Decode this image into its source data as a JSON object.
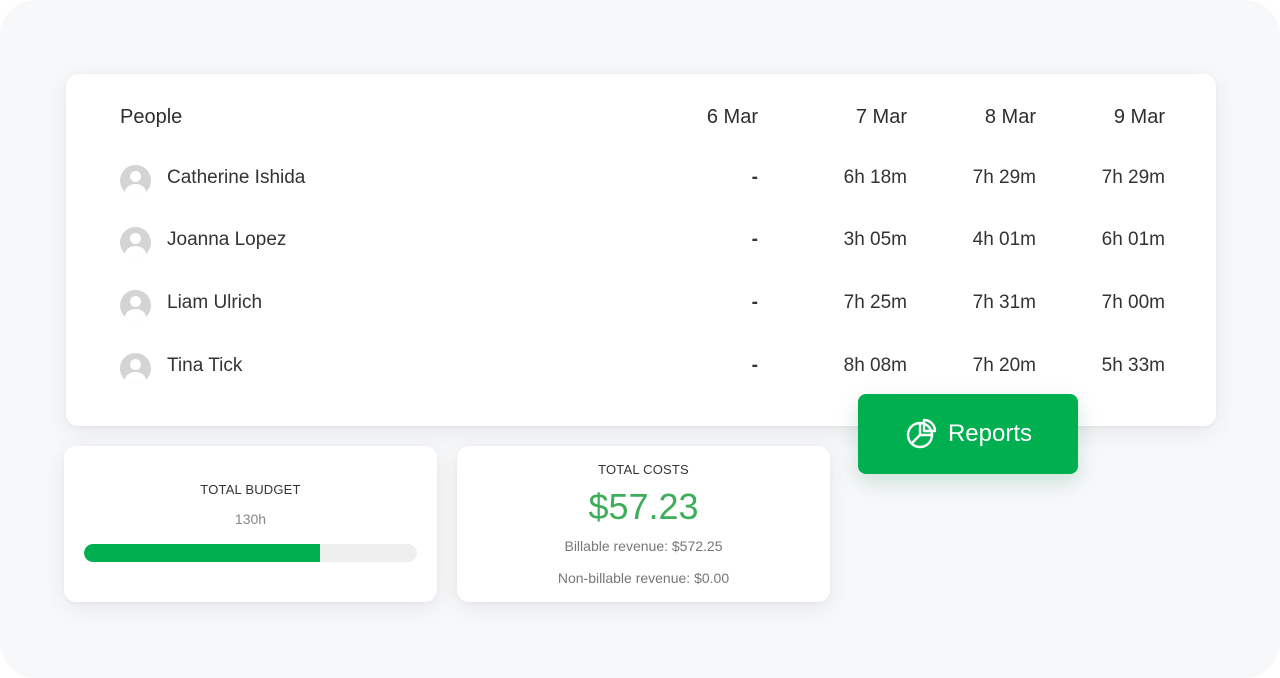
{
  "table": {
    "headers": {
      "people": "People",
      "days": [
        "6 Mar",
        "7 Mar",
        "8 Mar",
        "9 Mar"
      ]
    },
    "rows": [
      {
        "name": "Catherine Ishida",
        "values": [
          "-",
          "6h 18m",
          "7h 29m",
          "7h 29m"
        ]
      },
      {
        "name": "Joanna Lopez",
        "values": [
          "-",
          "3h 05m",
          "4h 01m",
          "6h 01m"
        ]
      },
      {
        "name": "Liam Ulrich",
        "values": [
          "-",
          "7h 25m",
          "7h 31m",
          "7h 00m"
        ]
      },
      {
        "name": "Tina Tick",
        "values": [
          "-",
          "8h 08m",
          "7h 20m",
          "5h 33m"
        ]
      }
    ]
  },
  "reports_button": {
    "label": "Reports",
    "icon": "pie-chart-icon"
  },
  "budget": {
    "title": "TOTAL BUDGET",
    "hours": "130h",
    "progress_fraction": 0.71
  },
  "costs": {
    "title": "TOTAL COSTS",
    "amount": "$57.23",
    "billable": "Billable revenue: $572.25",
    "non_billable": "Non-billable revenue: $0.00"
  },
  "colors": {
    "accent": "#00b050",
    "amount": "#3fae5a",
    "avatar": "#d4d4d4"
  }
}
